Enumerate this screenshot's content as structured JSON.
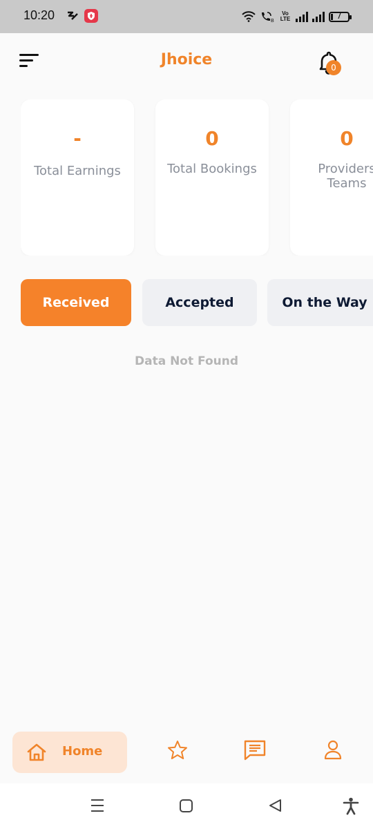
{
  "status_bar": {
    "time": "10:20",
    "battery_level": "7",
    "network_label": "Vo LTE"
  },
  "header": {
    "title": "Jhoice",
    "notification_count": "0"
  },
  "stats": [
    {
      "value": "-",
      "label": "Total Earnings"
    },
    {
      "value": "0",
      "label": "Total Bookings"
    },
    {
      "value": "0",
      "label": "Providers Teams"
    }
  ],
  "tabs": [
    {
      "label": "Received",
      "active": true
    },
    {
      "label": "Accepted",
      "active": false
    },
    {
      "label": "On the Way",
      "active": false
    }
  ],
  "empty_message": "Data Not Found",
  "bottom_nav": {
    "home_label": "Home",
    "items": [
      "home-icon",
      "star-icon",
      "chat-icon",
      "profile-icon"
    ]
  },
  "colors": {
    "accent": "#f0842a",
    "tab_active": "#f5822a",
    "tab_inactive": "#eff0f3",
    "home_pill": "#fde5d4"
  }
}
